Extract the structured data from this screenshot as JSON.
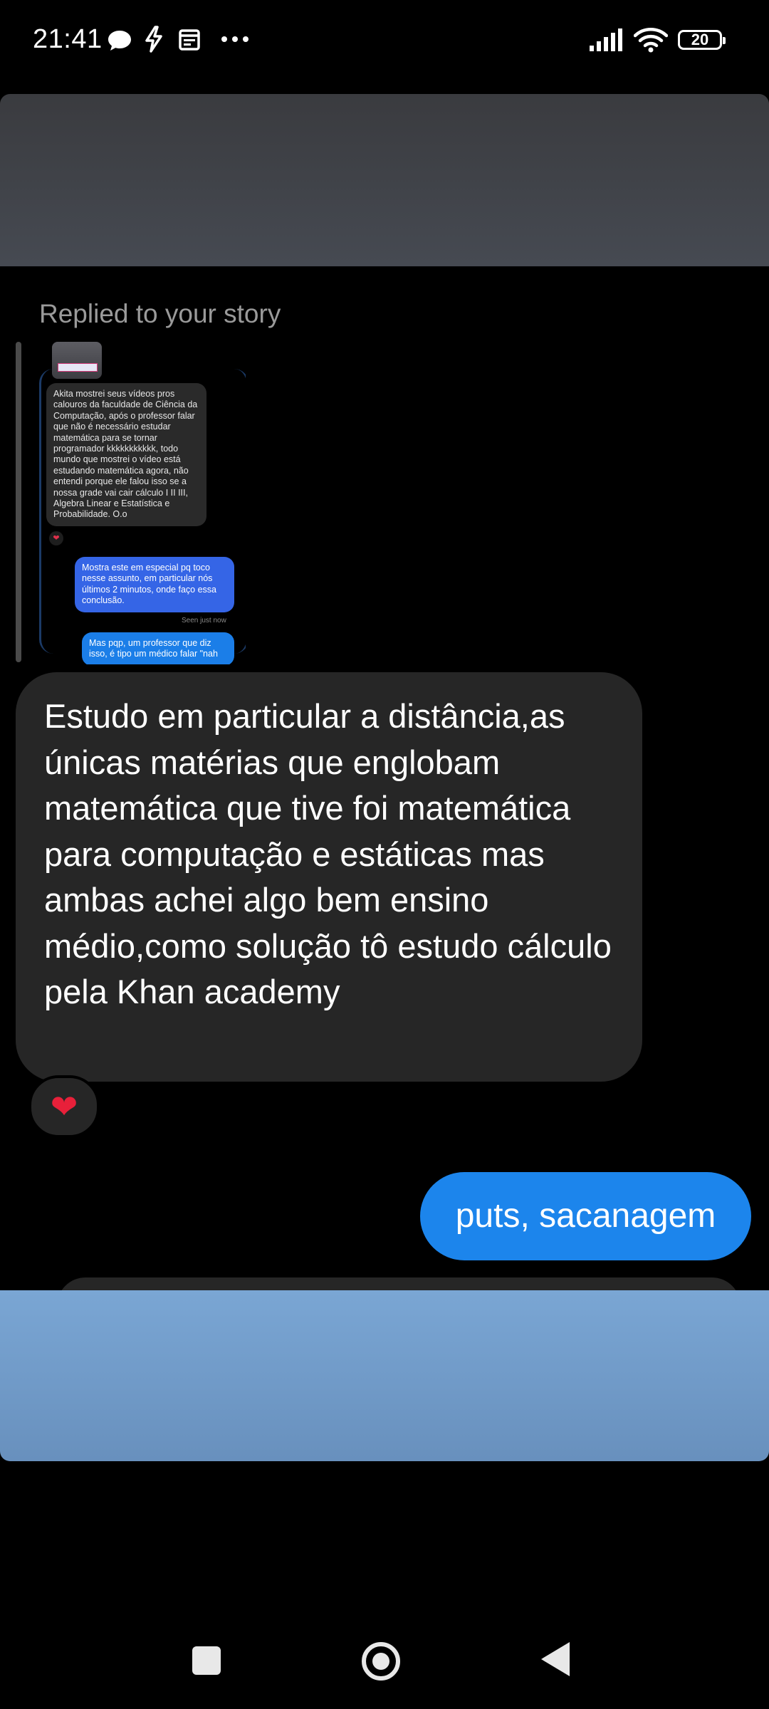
{
  "status_bar": {
    "time": "21:41",
    "battery": "20"
  },
  "story_reply": {
    "label": "Replied to your story"
  },
  "story_preview": {
    "incoming_text": "Akita mostrei seus vídeos pros calouros da faculdade de Ciência da Computação, após o professor falar que não é necessário estudar matemática para se tornar programador kkkkkkkkkkk, todo mundo que mostrei o vídeo está estudando matemática agora, não entendi porque ele falou isso se a nossa grade vai cair cálculo I II III, Algebra Linear e Estatística e Probabilidade. O.o",
    "outgoing_text_1": "Mostra este em especial pq toco nesse assunto, em particular nós últimos 2 minutos, onde faço essa conclusão.",
    "seen_text": "Seen just now",
    "outgoing_text_2": "Mas pqp, um professor que diz isso, é tipo um médico falar \"nah"
  },
  "messages": {
    "incoming": "Estudo em particular a distância,as únicas matérias que englobam matemática que tive foi matemática para computação e estáticas mas ambas achei algo bem ensino médio,como solução tô estudo cálculo pela Khan academy",
    "reaction": "❤",
    "outgoing": "puts, sacanagem"
  }
}
